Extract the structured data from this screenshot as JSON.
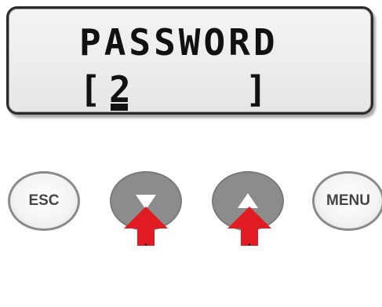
{
  "display": {
    "line1": "PASSWORD",
    "line2": {
      "open_bracket": "[",
      "entry": "2",
      "close_bracket": "]"
    }
  },
  "buttons": {
    "esc": {
      "label": "ESC"
    },
    "down": {
      "icon": "triangle-down-icon"
    },
    "up": {
      "icon": "triangle-up-icon"
    },
    "menu": {
      "label": "MENU"
    }
  },
  "indicators": {
    "icon": "red-arrow-up-icon",
    "color": "#e01b22"
  },
  "colors": {
    "lcd_background": "#ececec",
    "lcd_text": "#111111",
    "dark_button": "#8c8c8c",
    "indicator_red": "#e01b22"
  }
}
